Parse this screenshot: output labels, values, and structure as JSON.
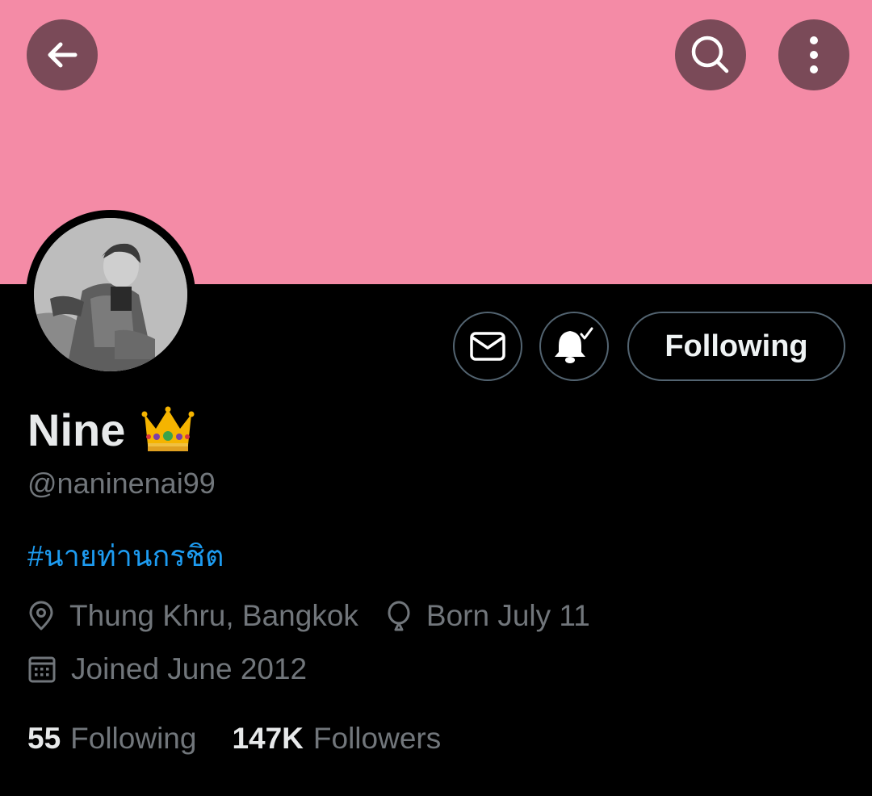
{
  "colors": {
    "banner": "#f48ba6",
    "header_button_bg": "#7a4a58",
    "accent_link": "#1d9bf0",
    "muted_text": "#71767b",
    "primary_text": "#e7e9ea",
    "button_border": "#536471"
  },
  "header": {
    "icons": [
      "back-arrow-icon",
      "search-icon",
      "more-vertical-icon"
    ]
  },
  "actions": {
    "message_icon": "envelope-icon",
    "notify_icon": "bell-check-icon",
    "following_label": "Following"
  },
  "profile": {
    "name": "Nine",
    "name_emoji": "crown-icon",
    "handle": "@naninenai99",
    "bio": "#นายท่านกรชิต",
    "location": "Thung Khru, Bangkok",
    "birthday": "Born July 11",
    "joined": "Joined June 2012"
  },
  "stats": {
    "following_count": "55",
    "following_label": "Following",
    "followers_count": "147K",
    "followers_label": "Followers"
  }
}
